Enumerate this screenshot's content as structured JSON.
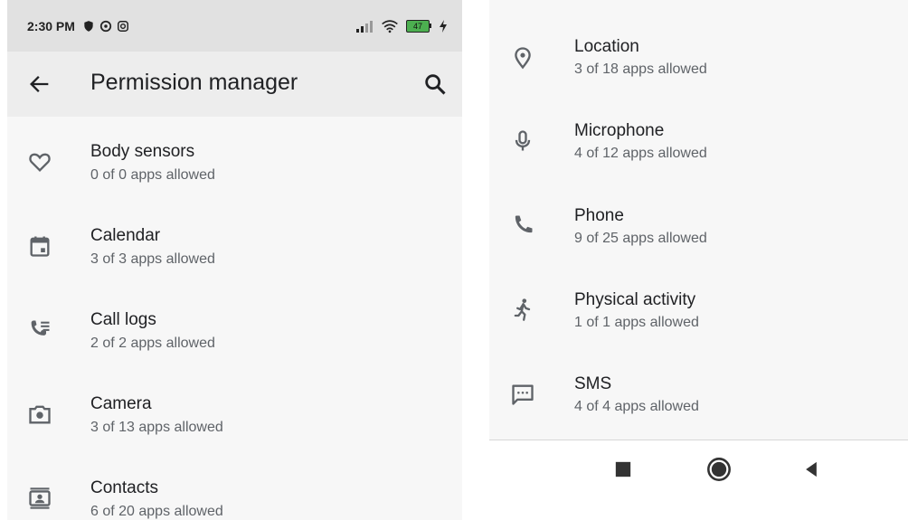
{
  "status_bar": {
    "time": "2:30 PM",
    "battery": "47"
  },
  "app_bar": {
    "title": "Permission manager"
  },
  "left_list": [
    {
      "label": "Body sensors",
      "summary": "0 of 0 apps allowed",
      "icon": "heart-icon"
    },
    {
      "label": "Calendar",
      "summary": "3 of 3 apps allowed",
      "icon": "calendar-icon"
    },
    {
      "label": "Call logs",
      "summary": "2 of 2 apps allowed",
      "icon": "call-log-icon"
    },
    {
      "label": "Camera",
      "summary": "3 of 13 apps allowed",
      "icon": "camera-icon"
    },
    {
      "label": "Contacts",
      "summary": "6 of 20 apps allowed",
      "icon": "contacts-icon"
    }
  ],
  "right_list": [
    {
      "label": "Location",
      "summary": "3 of 18 apps allowed",
      "icon": "location-pin-icon"
    },
    {
      "label": "Microphone",
      "summary": "4 of 12 apps allowed",
      "icon": "microphone-icon"
    },
    {
      "label": "Phone",
      "summary": "9 of 25 apps allowed",
      "icon": "phone-icon"
    },
    {
      "label": "Physical activity",
      "summary": "1 of 1 apps allowed",
      "icon": "walking-icon"
    },
    {
      "label": "SMS",
      "summary": "4 of 4 apps allowed",
      "icon": "sms-icon"
    }
  ],
  "nav_bar": {
    "buttons": [
      "recents",
      "home",
      "back"
    ]
  },
  "colors": {
    "panel_bg": "#f7f7f7",
    "status_bg": "#e1e1e1",
    "appbar_bg": "#ededed",
    "icon": "#5f6368",
    "text": "#202124"
  }
}
